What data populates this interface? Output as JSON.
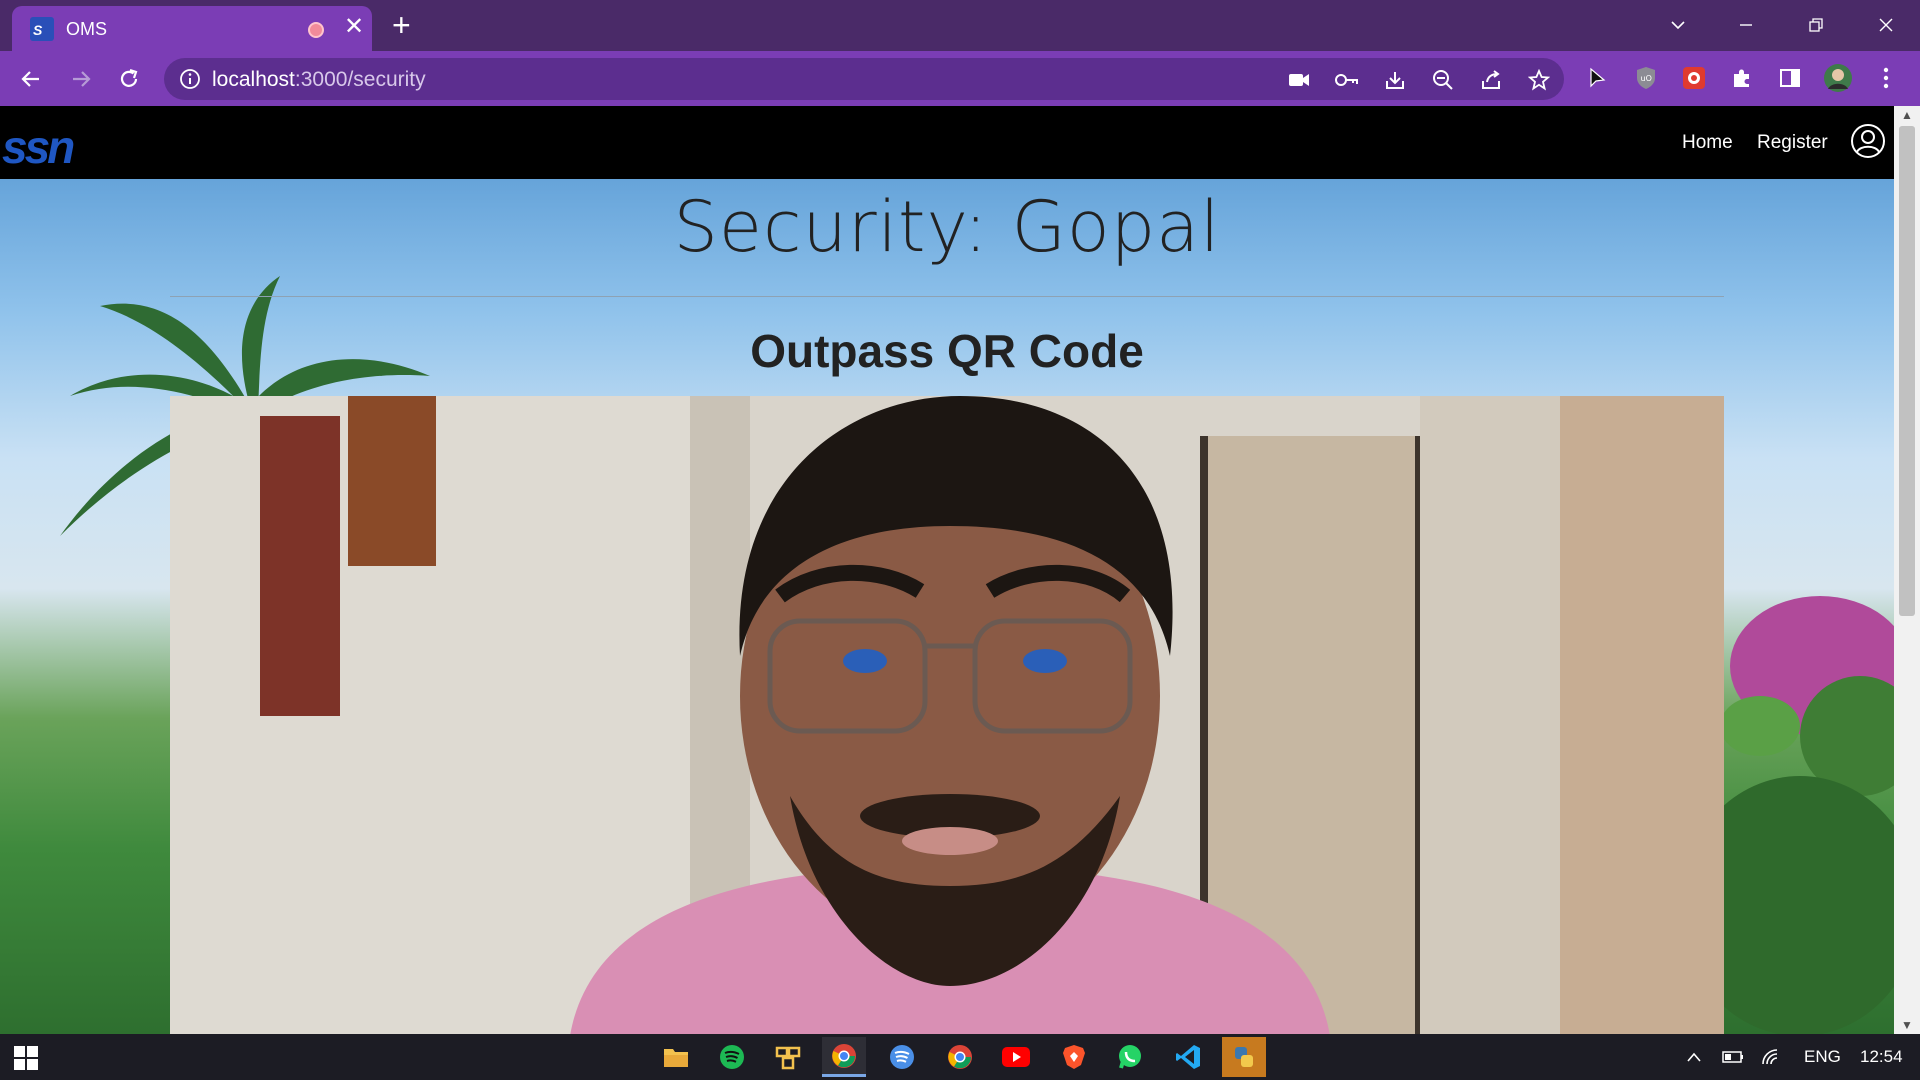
{
  "browser": {
    "tab_title": "OMS",
    "url_host": "localhost",
    "url_path": ":3000/security"
  },
  "navbar": {
    "brand": "ssn",
    "links": [
      "Home",
      "Register"
    ]
  },
  "page": {
    "title": "Security: Gopal",
    "subtitle": "Outpass QR Code"
  },
  "taskbar": {
    "language": "ENG",
    "time": "12:54"
  },
  "colors": {
    "tab_bar": "#4a2a68",
    "toolbar": "#7b3db5",
    "navbar": "#000000",
    "brand": "#1f57c3"
  }
}
